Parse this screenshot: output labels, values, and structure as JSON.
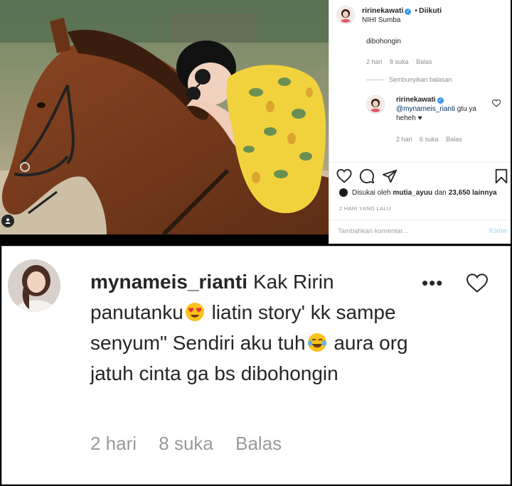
{
  "post": {
    "username": "ririnekawati",
    "verified_icon": "verified-badge-icon",
    "follow_separator": "•",
    "follow_status": "Diikuti",
    "location": "NIHI Sumba",
    "comment_tail": "dibohongin",
    "comment1_meta": {
      "time": "2 hari",
      "likes": "8 suka",
      "reply": "Balas"
    },
    "hide_replies": "Sembunyikan balasan",
    "reply": {
      "username": "ririnekawati",
      "mention": "@mynameis_rianti",
      "text_after_mention": "gtu ya",
      "text_line2": "heheh ♥",
      "time": "2 hari",
      "likes": "6 suka",
      "reply": "Balas"
    },
    "liked_by_prefix": "Disukai oleh",
    "liked_by_user": "mutia_ayuu",
    "liked_by_mid": "dan",
    "liked_by_count": "23,650 lainnya",
    "date": "2 HARI YANG LALU",
    "comment_placeholder": "Tambahkan komentar...",
    "post_button": "Kirim"
  },
  "zoom_comment": {
    "username": "mynameis_rianti",
    "text_part1": "Kak Ririn panutanku",
    "text_part2": "liatin story' kk sampe senyum\" Sendiri aku tuh",
    "text_part3": "aura org jatuh cinta ga bs dibohongin",
    "emoji1": "heart-eyes-emoji",
    "emoji2": "tears-of-joy-emoji",
    "time": "2 hari",
    "likes": "8 suka",
    "reply": "Balas",
    "more": "•••"
  },
  "colors": {
    "link_blue": "#003569",
    "verified_blue": "#3897f0",
    "meta_gray": "#8e8e8e",
    "post_button_disabled": "#b2dffc",
    "shirt_yellow": "#f2d23c",
    "horse_brown": "#7a3d1f"
  }
}
